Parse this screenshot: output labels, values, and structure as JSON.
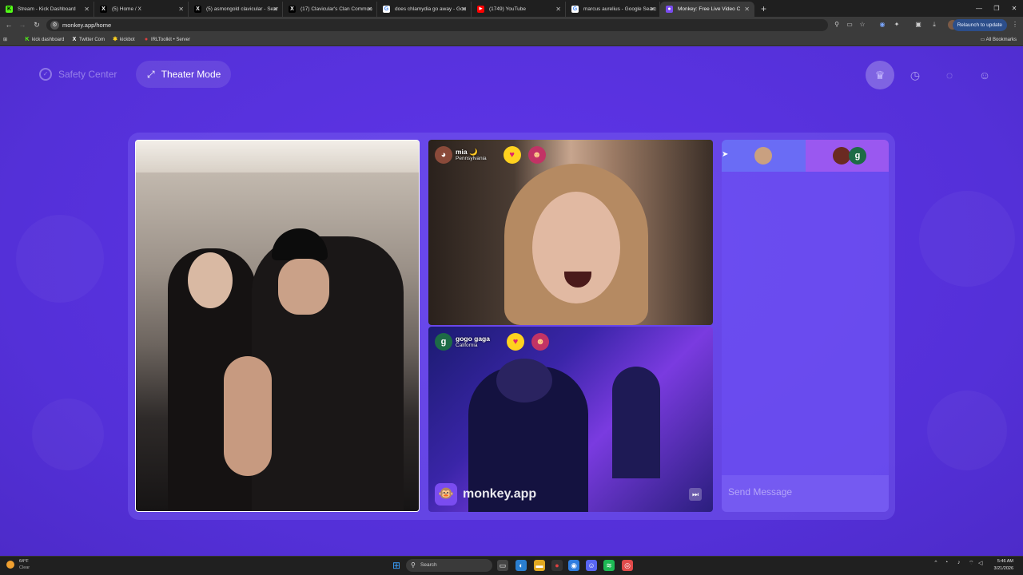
{
  "browser": {
    "tabs": [
      {
        "title": "Stream - Kick Dashboard",
        "favicon": "kick-icon",
        "color": "#53fc18",
        "glyph": "K",
        "active": false
      },
      {
        "title": "(5) Home / X",
        "favicon": "x-icon",
        "color": "#000000",
        "glyph": "X",
        "active": false
      },
      {
        "title": "(5) asmongold clavicular - Sear",
        "favicon": "x-icon",
        "color": "#000000",
        "glyph": "X",
        "active": false
      },
      {
        "title": "(17) Clavicular's Clan Commun",
        "favicon": "x-icon",
        "color": "#000000",
        "glyph": "X",
        "active": false
      },
      {
        "title": "does chlamydia go away - Goo",
        "favicon": "google-icon",
        "color": "#4285f4",
        "glyph": "G",
        "active": false
      },
      {
        "title": "(1749) YouTube",
        "favicon": "youtube-icon",
        "color": "#ff0000",
        "glyph": "▶",
        "active": false
      },
      {
        "title": "marcus aurelius - Google Searc",
        "favicon": "google-icon",
        "color": "#4285f4",
        "glyph": "G",
        "active": false
      },
      {
        "title": "Monkey: Free Live Video C",
        "favicon": "monkey-icon",
        "color": "#7a4cf0",
        "glyph": "◉",
        "active": true
      }
    ],
    "url": "monkey.app/home",
    "relaunch_label": "Relaunch to update",
    "bookmarks": [
      {
        "label": "kick dashboard",
        "icon": "kick-icon",
        "color": "#53fc18",
        "glyph": "K"
      },
      {
        "label": "Twitter Com",
        "icon": "x-icon",
        "color": "#ffffff",
        "glyph": "X"
      },
      {
        "label": "kickbot",
        "icon": "kickbot-icon",
        "color": "#ffd21f",
        "glyph": "✱"
      },
      {
        "label": "IRLToolkit • Server",
        "icon": "irltoolkit-icon",
        "color": "#e04040",
        "glyph": "●"
      }
    ],
    "all_bookmarks_label": "All Bookmarks"
  },
  "header": {
    "safety_center_label": "Safety Center",
    "theater_mode_label": "Theater Mode",
    "right_icons": [
      "crown-icon",
      "history-icon",
      "chat-icon",
      "profile-icon"
    ]
  },
  "videos": {
    "top": {
      "name": "mia 🌙",
      "location": "Pennsylvania",
      "badges": [
        "heart-badge-icon",
        "bot-badge-icon"
      ]
    },
    "bottom": {
      "name": "gogo gaga",
      "location": "California",
      "avatar_initial": "g",
      "badges": [
        "heart-badge-icon",
        "bot-badge-icon"
      ]
    },
    "brand": "monkey.app"
  },
  "chat": {
    "avatar_initial": "g",
    "placeholder": "Send Message"
  },
  "taskbar": {
    "temperature": "64°F",
    "condition": "Clear",
    "search_label": "Search",
    "time": "5:46 AM",
    "date": "3/21/2026"
  },
  "colors": {
    "page_bg": "#5a34e0",
    "accent": "#7a4cf0",
    "heart_badge": "#ffd21f",
    "bot_badge": "#c23365"
  }
}
